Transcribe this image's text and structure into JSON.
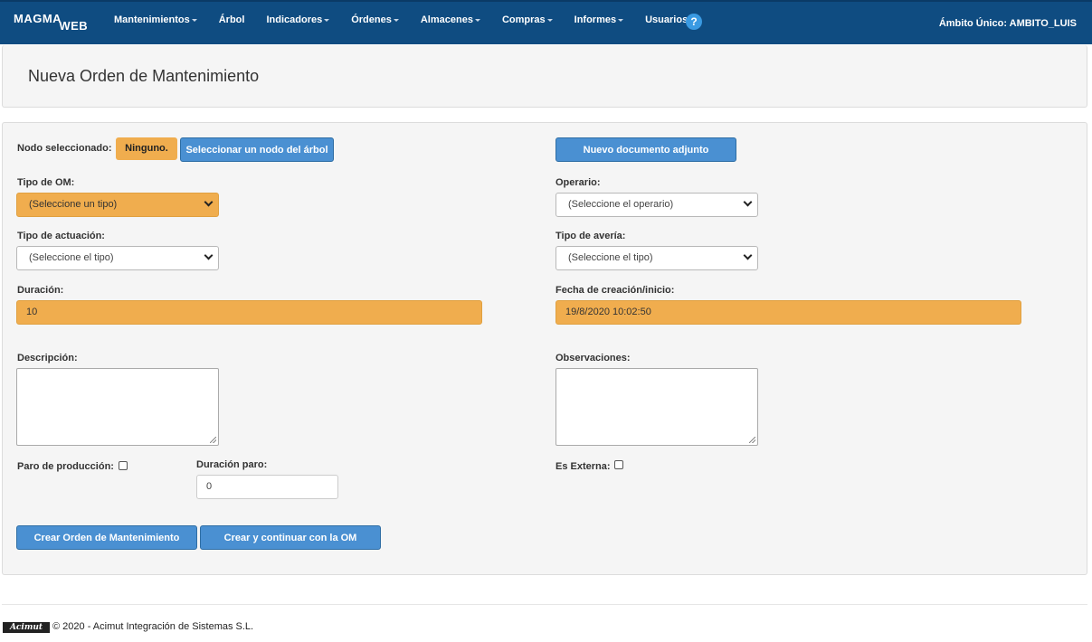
{
  "navbar": {
    "brand_main": "MAGMA",
    "brand_sub": "WEB",
    "items": [
      {
        "label": "Mantenimientos",
        "dropdown": true
      },
      {
        "label": "Árbol",
        "dropdown": false
      },
      {
        "label": "Indicadores",
        "dropdown": true
      },
      {
        "label": "Órdenes",
        "dropdown": true
      },
      {
        "label": "Almacenes",
        "dropdown": true
      },
      {
        "label": "Compras",
        "dropdown": true
      },
      {
        "label": "Informes",
        "dropdown": true
      },
      {
        "label": "Usuarios",
        "dropdown": true
      }
    ],
    "help_label": "?",
    "scope_label": "Ámbito Único: AMBITO_LUIS"
  },
  "page": {
    "title": "Nueva Orden de Mantenimiento"
  },
  "form": {
    "nodo_label": "Nodo seleccionado:",
    "nodo_value": "Ninguno.",
    "select_node_button": "Seleccionar un nodo del árbol",
    "new_attachment_button": "Nuevo documento adjunto",
    "tipo_om_label": "Tipo de OM:",
    "tipo_om_value": "(Seleccione un tipo)",
    "operario_label": "Operario:",
    "operario_value": "(Seleccione el operario)",
    "tipo_actuacion_label": "Tipo de actuación:",
    "tipo_actuacion_value": "(Seleccione el tipo)",
    "tipo_averia_label": "Tipo de avería:",
    "tipo_averia_value": "(Seleccione el tipo)",
    "duracion_label": "Duración:",
    "duracion_value": "10",
    "fecha_label": "Fecha de creación/inicio:",
    "fecha_value": "19/8/2020 10:02:50",
    "descripcion_label": "Descripción:",
    "observaciones_label": "Observaciones:",
    "paro_label": "Paro de producción:",
    "duracion_paro_label": "Duración paro:",
    "duracion_paro_value": "0",
    "externa_label": "Es Externa:",
    "create_button": "Crear Orden de Mantenimiento",
    "create_continue_button": "Crear y continuar con la OM"
  },
  "footer": {
    "logo_text": "Acimut",
    "copyright": "© 2020 - Acimut Integración de Sistemas S.L."
  },
  "colors": {
    "navbar": "#0f4c81",
    "button": "#4a90d2",
    "warning": "#f0ad4e",
    "panel": "#f5f5f5"
  }
}
